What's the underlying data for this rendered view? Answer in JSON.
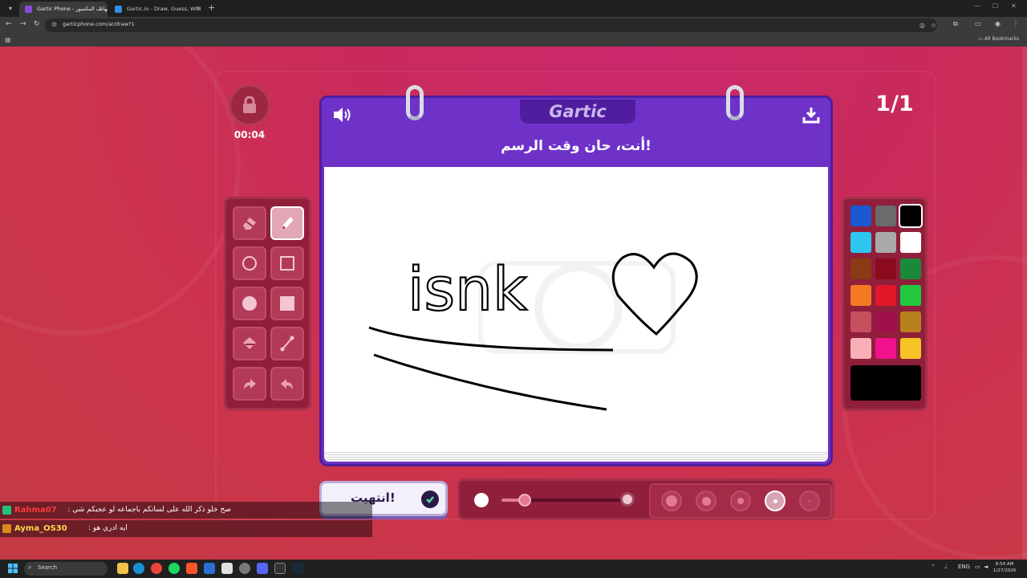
{
  "browser": {
    "tabs": [
      {
        "title": "Gartic Phone - الهاتف المكسور",
        "active": true
      },
      {
        "title": "Gartic.io - Draw, Guess, WIN",
        "active": false
      }
    ],
    "url": "garticphone.com/ar/draw?1",
    "bookmarks_label": "All Bookmarks"
  },
  "game": {
    "timer": "00:04",
    "round_counter": "1/1",
    "logo_text": "Gartic",
    "prompt": "أنت، حان وقت الرسم!",
    "drawing_text": "isnk",
    "done_label": "انتهيت!",
    "tools": [
      {
        "name": "eraser",
        "active": false
      },
      {
        "name": "pencil",
        "active": true
      },
      {
        "name": "circle-outline",
        "active": false
      },
      {
        "name": "square-outline",
        "active": false
      },
      {
        "name": "circle-filled",
        "active": false
      },
      {
        "name": "square-filled",
        "active": false
      },
      {
        "name": "fill-bucket",
        "active": false
      },
      {
        "name": "line",
        "active": false
      },
      {
        "name": "redo",
        "active": false
      },
      {
        "name": "undo",
        "active": false
      }
    ],
    "palette": [
      "#1a58d4",
      "#6b6b6b",
      "#000000",
      "#2ec6f0",
      "#a9a9a9",
      "#ffffff",
      "#8a3a14",
      "#8b0a1c",
      "#1a8a3a",
      "#f37a23",
      "#e3172a",
      "#23c83f",
      "#c65060",
      "#a0104a",
      "#b7801f",
      "#f8b0b6",
      "#f0128c",
      "#f7c427"
    ],
    "selected_color": "#000000",
    "opacity_fraction": 0.18,
    "brush_sizes_selected_index": 3
  },
  "chat": [
    {
      "name": "Rahma07",
      "message": "صح خلو ذكر الله على لسانكم باجماعه لو عجبكم شي :",
      "badge_color": "#26c07e"
    },
    {
      "name": "Ayma_OS30",
      "message": "ايه ادري هو :",
      "badge_color": "#d98a1e"
    }
  ],
  "taskbar": {
    "search_label": "Search",
    "lang": "ENG",
    "time": "8:54 AM",
    "date": "1/27/2026"
  }
}
